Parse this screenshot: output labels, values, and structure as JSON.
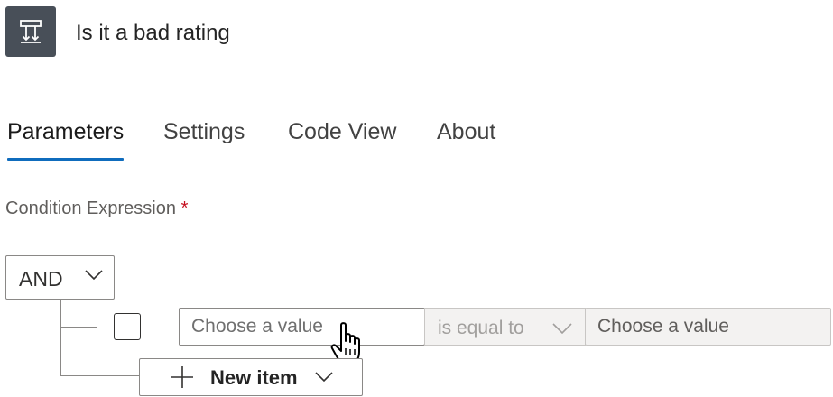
{
  "header": {
    "icon": "condition-icon",
    "title": "Is it a bad rating"
  },
  "tabs": [
    {
      "label": "Parameters",
      "active": true
    },
    {
      "label": "Settings",
      "active": false
    },
    {
      "label": "Code View",
      "active": false
    },
    {
      "label": "About",
      "active": false
    }
  ],
  "condition": {
    "label": "Condition Expression",
    "required_marker": "*",
    "group_operator": "AND",
    "row": {
      "left_placeholder": "Choose a value",
      "operator": "is equal to",
      "right_placeholder": "Choose a value"
    },
    "new_item_label": "New item"
  },
  "colors": {
    "accent": "#0f6cbd",
    "required": "#c50f1f",
    "icon_bg": "#484f58"
  }
}
